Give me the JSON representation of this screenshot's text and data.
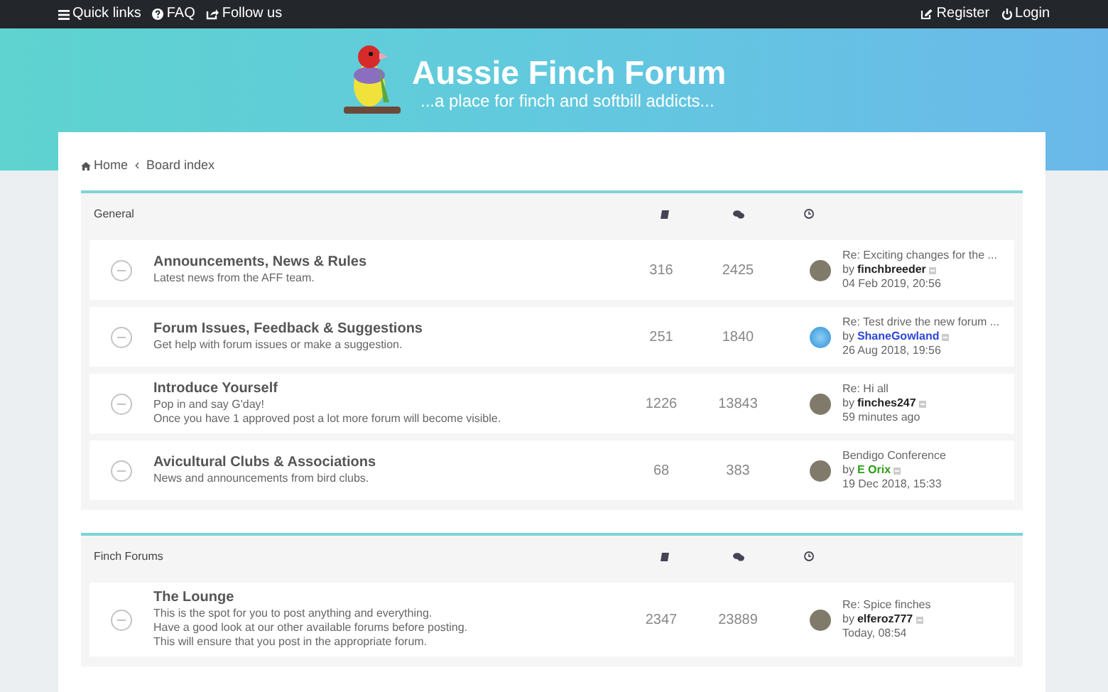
{
  "navbar": {
    "left": [
      {
        "kind": "menu",
        "label": "Quick links"
      },
      {
        "kind": "faq",
        "label": "FAQ"
      },
      {
        "kind": "share",
        "label": "Follow us"
      }
    ],
    "right": [
      {
        "kind": "edit",
        "label": "Register"
      },
      {
        "kind": "power",
        "label": "Login"
      }
    ]
  },
  "header": {
    "title": "Aussie Finch Forum",
    "tagline": "...a place for finch and softbill addicts..."
  },
  "breadcrumbs": [
    "Home",
    "Board index"
  ],
  "categories": [
    {
      "title": "General",
      "forums": [
        {
          "title": "Announcements, News & Rules",
          "description": [
            "Latest news from the AFF team."
          ],
          "topics": "316",
          "posts": "2425",
          "last_post": {
            "subject": "Re: Exciting changes for the ...",
            "by": "by",
            "user": "finchbreeder",
            "color": "#222222",
            "time": "04 Feb 2019, 20:56",
            "avatar": {
              "kind": "photo"
            }
          }
        },
        {
          "title": "Forum Issues, Feedback & Suggestions",
          "description": [
            "Get help with forum issues or make a suggestion."
          ],
          "topics": "251",
          "posts": "1840",
          "last_post": {
            "subject": "Re: Test drive the new forum ...",
            "by": "by",
            "user": "ShaneGowland",
            "color": "#2e46d8",
            "time": "26 Aug 2018, 19:56",
            "avatar": {
              "kind": "globe"
            }
          }
        },
        {
          "title": "Introduce Yourself",
          "description": [
            "Pop in and say G'day!",
            "Once you have 1 approved post a lot more forum will become visible."
          ],
          "topics": "1226",
          "posts": "13843",
          "last_post": {
            "subject": "Re: Hi all",
            "by": "by",
            "user": "finches247",
            "color": "#222222",
            "time": "59 minutes ago",
            "avatar": {
              "kind": "photo"
            }
          }
        },
        {
          "title": "Avicultural Clubs & Associations",
          "description": [
            "News and announcements from bird clubs."
          ],
          "topics": "68",
          "posts": "383",
          "last_post": {
            "subject": "Bendigo Conference",
            "by": "by",
            "user": "E Orix",
            "color": "#2f9e17",
            "time": "19 Dec 2018, 15:33",
            "avatar": {
              "kind": "photo"
            }
          }
        }
      ]
    },
    {
      "title": "Finch Forums",
      "forums": [
        {
          "title": "The Lounge",
          "description": [
            "This is the spot for you to post anything and everything.",
            "Have a good look at our other available forums before posting.",
            "This will ensure that you post in the appropriate forum."
          ],
          "topics": "2347",
          "posts": "23889",
          "last_post": {
            "subject": "Re: Spice finches",
            "by": "by",
            "user": "elferoz777",
            "color": "#222222",
            "time": "Today, 08:54",
            "avatar": {
              "kind": "photo"
            }
          }
        }
      ]
    }
  ]
}
